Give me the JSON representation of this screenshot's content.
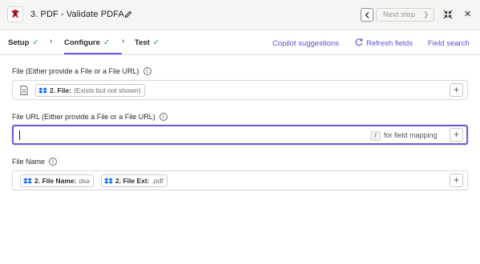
{
  "header": {
    "step_title": "3. PDF - Validate PDFA",
    "next_step_label": "Next step",
    "icons": [
      "app-logo-icon",
      "pencil-icon",
      "chevron-left-icon",
      "chevron-right-icon",
      "collapse-icon",
      "close-icon"
    ]
  },
  "tabs": {
    "items": [
      {
        "label": "Setup",
        "done": true
      },
      {
        "label": "Configure",
        "done": true,
        "active": true
      },
      {
        "label": "Test",
        "done": true
      }
    ],
    "copilot_label": "Copilot suggestions",
    "refresh_label": "Refresh fields",
    "field_search_label": "Field search"
  },
  "form": {
    "file": {
      "label": "File (Either provide a File or a File URL)",
      "pills": [
        {
          "key": "2. File:",
          "value": "(Exists but not shown)"
        }
      ]
    },
    "file_url": {
      "label": "File URL (Either provide a File or a File URL)",
      "value": "",
      "shortcut_key": "/",
      "hint": "for field mapping"
    },
    "file_name": {
      "label": "File Name",
      "pills": [
        {
          "key": "2. File Name:",
          "value": "dsa"
        },
        {
          "key": "2. File Ext:",
          "value": ".pdf"
        }
      ]
    }
  },
  "colors": {
    "accent": "#695be8",
    "check": "#1e9e5a",
    "dropbox": "#0061fe",
    "logo_red": "#c8102e"
  }
}
